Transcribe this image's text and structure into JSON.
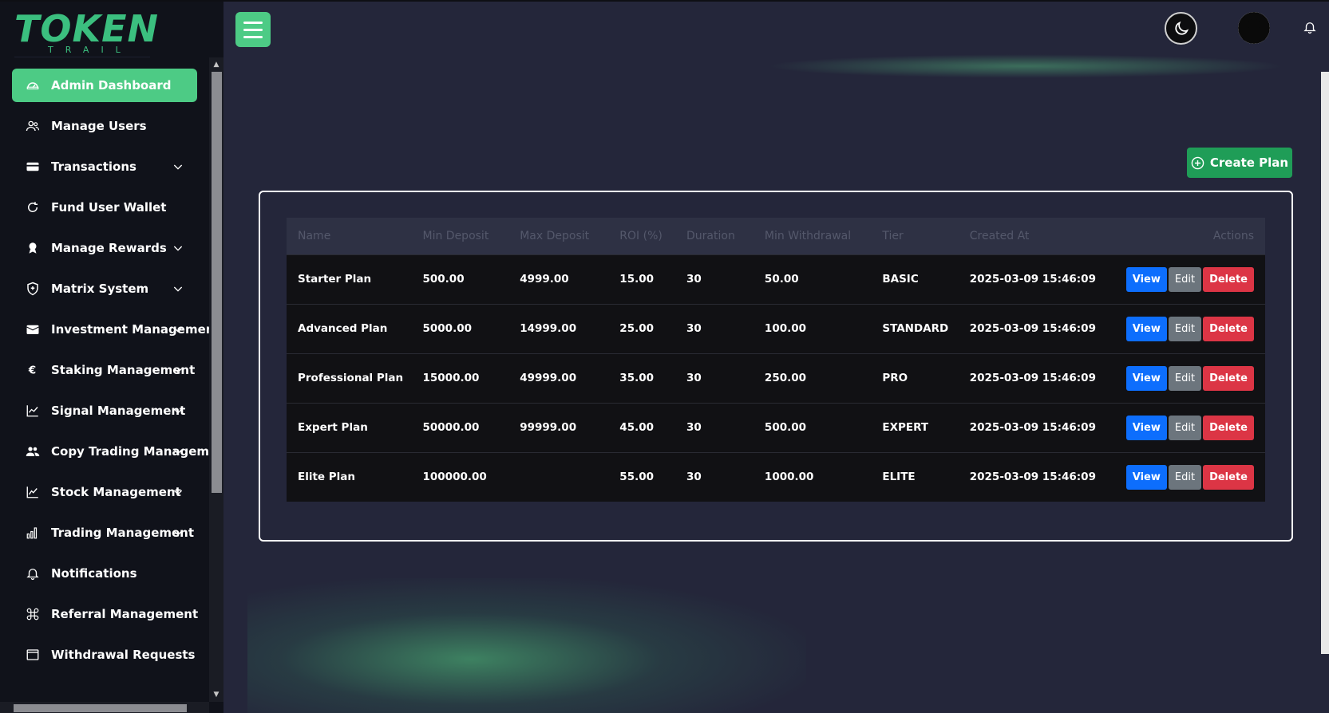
{
  "logo": {
    "main": "TOKEN",
    "sub": "TRAIL"
  },
  "sidebar": {
    "items": [
      {
        "label": "Admin Dashboard",
        "icon": "dashboard-icon",
        "active": true,
        "expandable": false
      },
      {
        "label": "Manage Users",
        "icon": "users-icon",
        "active": false,
        "expandable": false
      },
      {
        "label": "Transactions",
        "icon": "credit-card-icon",
        "active": false,
        "expandable": true
      },
      {
        "label": "Fund User Wallet",
        "icon": "refresh-icon",
        "active": false,
        "expandable": false
      },
      {
        "label": "Manage Rewards",
        "icon": "award-icon",
        "active": false,
        "expandable": true
      },
      {
        "label": "Matrix System",
        "icon": "shield-icon",
        "active": false,
        "expandable": true
      },
      {
        "label": "Investment Management",
        "icon": "wallet-icon",
        "active": false,
        "expandable": true
      },
      {
        "label": "Staking Management",
        "icon": "euro-icon",
        "active": false,
        "expandable": true
      },
      {
        "label": "Signal Management",
        "icon": "chart-line-icon",
        "active": false,
        "expandable": true
      },
      {
        "label": "Copy Trading Management",
        "icon": "people-icon",
        "active": false,
        "expandable": true
      },
      {
        "label": "Stock Management",
        "icon": "stock-chart-icon",
        "active": false,
        "expandable": true
      },
      {
        "label": "Trading Management",
        "icon": "bar-chart-icon",
        "active": false,
        "expandable": true
      },
      {
        "label": "Notifications",
        "icon": "bell-icon",
        "active": false,
        "expandable": false
      },
      {
        "label": "Referral Management",
        "icon": "command-icon",
        "active": false,
        "expandable": false
      },
      {
        "label": "Withdrawal Requests",
        "icon": "window-icon",
        "active": false,
        "expandable": false
      }
    ]
  },
  "header": {
    "menu_icon": "hamburger-icon",
    "theme_icon": "moon-icon",
    "avatar_icon": "user-avatar-icon",
    "bell_icon": "bell-icon"
  },
  "create_plan": {
    "label": "Create Plan",
    "icon": "plus-circle-icon"
  },
  "table": {
    "headers": [
      "Name",
      "Min Deposit",
      "Max Deposit",
      "ROI (%)",
      "Duration",
      "Min Withdrawal",
      "Tier",
      "Created At",
      "Actions"
    ],
    "rows": [
      [
        "Starter Plan",
        "500.00",
        "4999.00",
        "15.00",
        "30",
        "50.00",
        "BASIC",
        "2025-03-09 15:46:09"
      ],
      [
        "Advanced Plan",
        "5000.00",
        "14999.00",
        "25.00",
        "30",
        "100.00",
        "STANDARD",
        "2025-03-09 15:46:09"
      ],
      [
        "Professional Plan",
        "15000.00",
        "49999.00",
        "35.00",
        "30",
        "250.00",
        "PRO",
        "2025-03-09 15:46:09"
      ],
      [
        "Expert Plan",
        "50000.00",
        "99999.00",
        "45.00",
        "30",
        "500.00",
        "EXPERT",
        "2025-03-09 15:46:09"
      ],
      [
        "Elite Plan",
        "100000.00",
        "",
        "55.00",
        "30",
        "1000.00",
        "ELITE",
        "2025-03-09 15:46:09"
      ]
    ],
    "actions": {
      "view": "View",
      "edit": "Edit",
      "delete": "Delete"
    }
  },
  "colors": {
    "accent": "#4dcb85",
    "background": "#24263a",
    "sidebar": "#10121a",
    "view": "#0d6efd",
    "edit": "#6c757d",
    "delete": "#dc3545",
    "create": "#1f9d57"
  }
}
